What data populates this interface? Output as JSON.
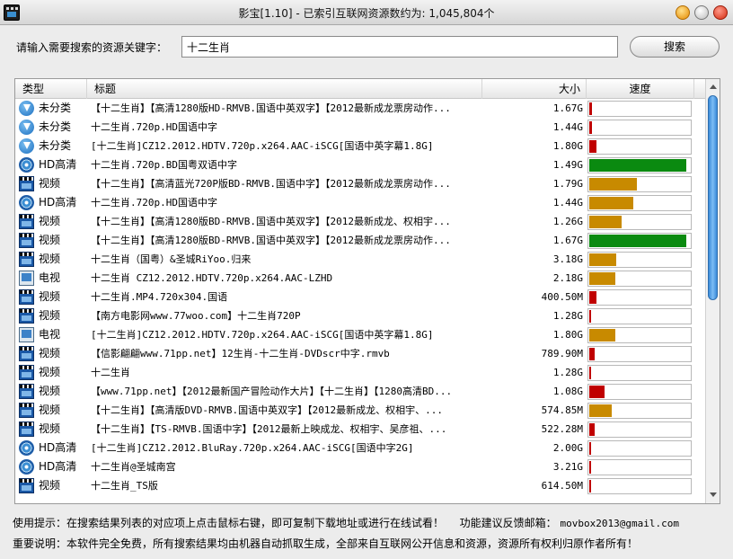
{
  "window": {
    "title": "影宝[1.10] - 已索引互联网资源数约为: 1,045,804个"
  },
  "search": {
    "label": "请输入需要搜索的资源关键字：",
    "value": "十二生肖",
    "button": "搜索"
  },
  "table": {
    "headers": {
      "type": "类型",
      "title": "标题",
      "size": "大小",
      "speed": "速度"
    },
    "rows": [
      {
        "type": "未分类",
        "icon": "download-icon",
        "title": "【十二生肖】【高清1280版HD-RMVB.国语中英双字】【2012最新成龙票房动作...",
        "size": "1.67G",
        "speed": 0.03,
        "speed_color": "#c00000"
      },
      {
        "type": "未分类",
        "icon": "download-icon",
        "title": "十二生肖.720p.HD国语中字",
        "size": "1.44G",
        "speed": 0.03,
        "speed_color": "#c00000"
      },
      {
        "type": "未分类",
        "icon": "download-icon",
        "title": "[十二生肖]CZ12.2012.HDTV.720p.x264.AAC-iSCG[国语中英字幕1.8G]",
        "size": "1.80G",
        "speed": 0.07,
        "speed_color": "#c00000"
      },
      {
        "type": "HD高清",
        "icon": "disc-icon",
        "title": "十二生肖.720p.BD国粤双语中字",
        "size": "1.49G",
        "speed": 0.96,
        "speed_color": "#0a8a10"
      },
      {
        "type": "视频",
        "icon": "video-icon",
        "title": "【十二生肖】【高清蓝光720P版BD-RMVB.国语中字】【2012最新成龙票房动作...",
        "size": "1.79G",
        "speed": 0.47,
        "speed_color": "#c88a00"
      },
      {
        "type": "HD高清",
        "icon": "disc-icon",
        "title": "十二生肖.720p.HD国语中字",
        "size": "1.44G",
        "speed": 0.44,
        "speed_color": "#c88a00"
      },
      {
        "type": "视频",
        "icon": "video-icon",
        "title": "【十二生肖】【高清1280版BD-RMVB.国语中英双字】【2012最新成龙、权相宇...",
        "size": "1.26G",
        "speed": 0.32,
        "speed_color": "#c88a00"
      },
      {
        "type": "视频",
        "icon": "video-icon",
        "title": "【十二生肖】【高清1280版BD-RMVB.国语中英双字】【2012最新成龙票房动作...",
        "size": "1.67G",
        "speed": 0.96,
        "speed_color": "#0a8a10"
      },
      {
        "type": "视频",
        "icon": "video-icon",
        "title": "十二生肖（国粤）&圣城RiYoo.归来",
        "size": "3.18G",
        "speed": 0.27,
        "speed_color": "#c88a00"
      },
      {
        "type": "电视",
        "icon": "tv-icon",
        "title": "十二生肖 CZ12.2012.HDTV.720p.x264.AAC-LZHD",
        "size": "2.18G",
        "speed": 0.26,
        "speed_color": "#c88a00"
      },
      {
        "type": "视频",
        "icon": "video-icon",
        "title": "十二生肖.MP4.720x304.国语",
        "size": "400.50M",
        "speed": 0.07,
        "speed_color": "#c00000"
      },
      {
        "type": "视频",
        "icon": "video-icon",
        "title": "【南方电影网www.77woo.com】十二生肖720P",
        "size": "1.28G",
        "speed": 0.01,
        "speed_color": "#c00000"
      },
      {
        "type": "电视",
        "icon": "tv-icon",
        "title": "[十二生肖]CZ12.2012.HDTV.720p.x264.AAC-iSCG[国语中英字幕1.8G]",
        "size": "1.80G",
        "speed": 0.26,
        "speed_color": "#c88a00"
      },
      {
        "type": "视频",
        "icon": "video-icon",
        "title": "【信影翩翩www.71pp.net】12生肖-十二生肖-DVDscr中字.rmvb",
        "size": "789.90M",
        "speed": 0.05,
        "speed_color": "#c00000"
      },
      {
        "type": "视频",
        "icon": "video-icon",
        "title": "十二生肖",
        "size": "1.28G",
        "speed": 0.01,
        "speed_color": "#c00000"
      },
      {
        "type": "视频",
        "icon": "video-icon",
        "title": "【www.71pp.net】【2012最新国产冒险动作大片】【十二生肖】【1280高清BD...",
        "size": "1.08G",
        "speed": 0.15,
        "speed_color": "#c00000"
      },
      {
        "type": "视频",
        "icon": "video-icon",
        "title": "【十二生肖】【高清版DVD-RMVB.国语中英双字】【2012最新成龙、权相宇、...",
        "size": "574.85M",
        "speed": 0.22,
        "speed_color": "#c88a00"
      },
      {
        "type": "视频",
        "icon": "video-icon",
        "title": "【十二生肖】【TS-RMVB.国语中字】【2012最新上映成龙、权相宇、吴彦祖、...",
        "size": "522.28M",
        "speed": 0.05,
        "speed_color": "#c00000"
      },
      {
        "type": "HD高清",
        "icon": "disc-icon",
        "title": "[十二生肖]CZ12.2012.BluRay.720p.x264.AAC-iSCG[国语中字2G]",
        "size": "2.00G",
        "speed": 0.01,
        "speed_color": "#c00000"
      },
      {
        "type": "HD高清",
        "icon": "disc-icon",
        "title": "十二生肖@圣城南宫",
        "size": "3.21G",
        "speed": 0.01,
        "speed_color": "#c00000"
      },
      {
        "type": "视频",
        "icon": "video-icon",
        "title": "十二生肖_TS版",
        "size": "614.50M",
        "speed": 0.01,
        "speed_color": "#c00000"
      }
    ]
  },
  "footer": {
    "tip": "使用提示：在搜索结果列表的对应项上点击鼠标右键，即可复制下载地址或进行在线试看！",
    "feedback_label": "功能建议反馈邮箱：",
    "email": "movbox2013@gmail.com",
    "notice": "重要说明：本软件完全免费，所有搜索结果均由机器自动抓取生成，全部来自互联网公开信息和资源，资源所有权利归原作者所有！"
  }
}
